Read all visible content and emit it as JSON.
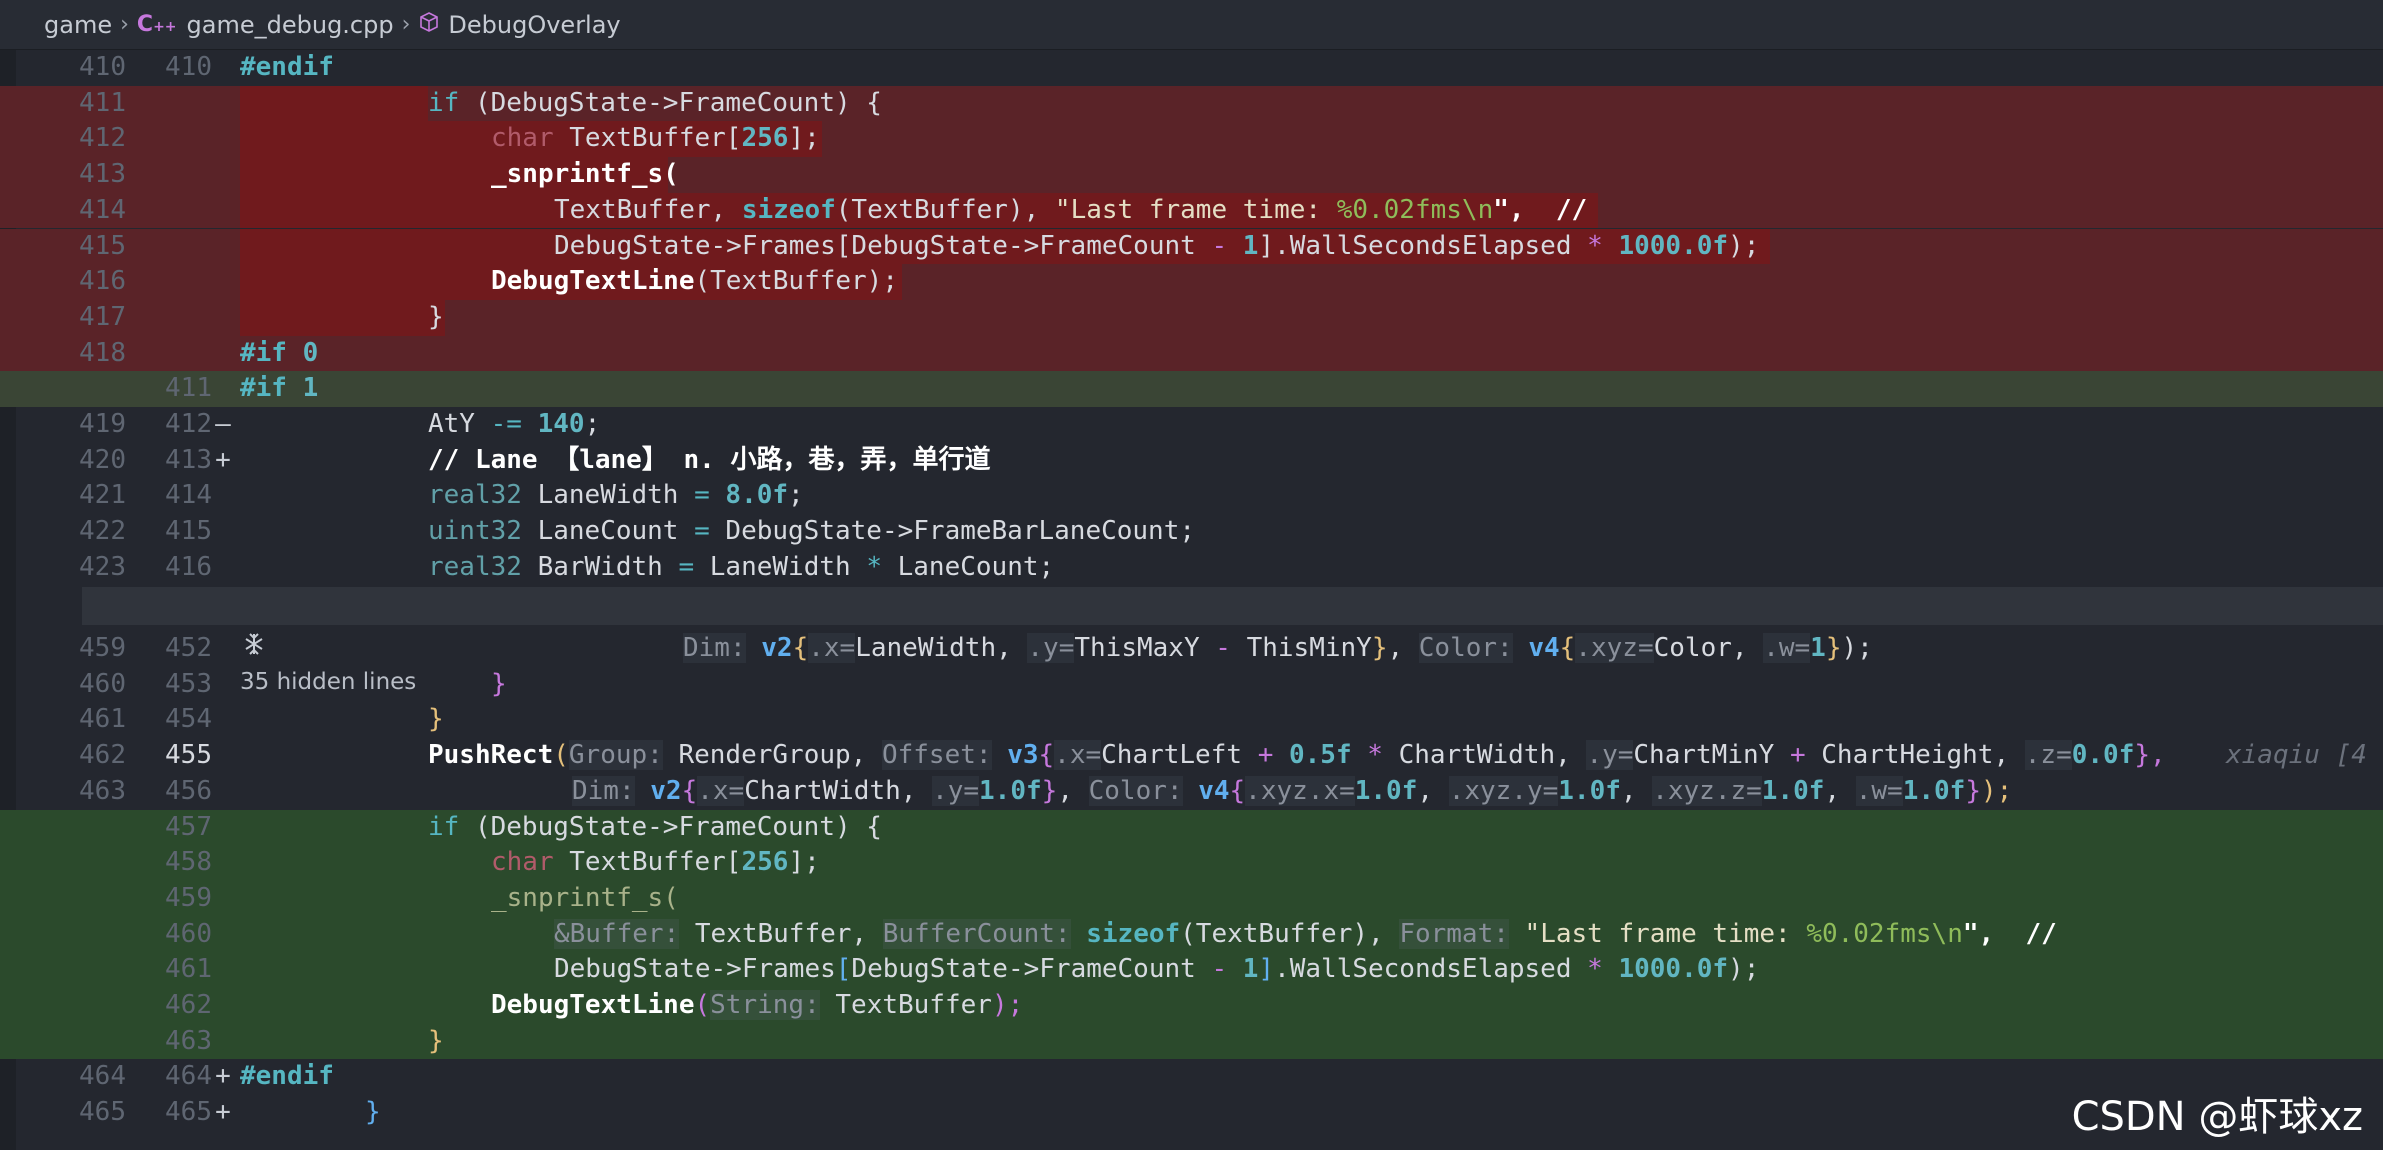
{
  "breadcrumb": {
    "items": [
      "game",
      "game_debug.cpp",
      "DebugOverlay"
    ],
    "file_icon_label": "C++"
  },
  "folded": {
    "label": "35 hidden lines"
  },
  "blame": {
    "text": "xiaqiu [4"
  },
  "watermark": {
    "text": "CSDN @虾球xz"
  },
  "lines": [
    {
      "type": "neutral",
      "ln1": "410",
      "ln2": "410",
      "marker": ""
    },
    {
      "type": "del",
      "ln1": "411",
      "ln2": "",
      "marker": "—"
    },
    {
      "type": "del",
      "ln1": "412",
      "ln2": "",
      "marker": "—"
    },
    {
      "type": "del",
      "ln1": "413",
      "ln2": "",
      "marker": "—"
    },
    {
      "type": "del",
      "ln1": "414",
      "ln2": "",
      "marker": "—"
    },
    {
      "type": "del",
      "ln1": "415",
      "ln2": "",
      "marker": "—"
    },
    {
      "type": "del",
      "ln1": "416",
      "ln2": "",
      "marker": "—"
    },
    {
      "type": "del",
      "ln1": "417",
      "ln2": "",
      "marker": "—"
    },
    {
      "type": "del",
      "ln1": "418",
      "ln2": "",
      "marker": "—"
    },
    {
      "type": "addplain",
      "ln1": "",
      "ln2": "411",
      "marker": "+"
    },
    {
      "type": "neutral",
      "ln1": "419",
      "ln2": "412",
      "marker": ""
    },
    {
      "type": "neutral",
      "ln1": "420",
      "ln2": "413",
      "marker": ""
    },
    {
      "type": "neutral",
      "ln1": "421",
      "ln2": "414",
      "marker": ""
    },
    {
      "type": "neutral",
      "ln1": "422",
      "ln2": "415",
      "marker": ""
    },
    {
      "type": "neutral",
      "ln1": "423",
      "ln2": "416",
      "marker": ""
    },
    {
      "type": "neutral",
      "ln1": "459",
      "ln2": "452",
      "marker": ""
    },
    {
      "type": "neutral",
      "ln1": "460",
      "ln2": "453",
      "marker": ""
    },
    {
      "type": "neutral",
      "ln1": "461",
      "ln2": "454",
      "marker": ""
    },
    {
      "type": "neutral",
      "ln1": "462",
      "ln2": "455",
      "marker": ""
    },
    {
      "type": "neutral",
      "ln1": "463",
      "ln2": "456",
      "marker": ""
    },
    {
      "type": "add",
      "ln1": "",
      "ln2": "457",
      "marker": "+"
    },
    {
      "type": "add",
      "ln1": "",
      "ln2": "458",
      "marker": "+"
    },
    {
      "type": "add",
      "ln1": "",
      "ln2": "459",
      "marker": "+"
    },
    {
      "type": "add",
      "ln1": "",
      "ln2": "460",
      "marker": "+"
    },
    {
      "type": "add",
      "ln1": "",
      "ln2": "461",
      "marker": "+"
    },
    {
      "type": "add",
      "ln1": "",
      "ln2": "462",
      "marker": "+"
    },
    {
      "type": "add",
      "ln1": "",
      "ln2": "463",
      "marker": "+"
    },
    {
      "type": "neutral",
      "ln1": "464",
      "ln2": "464",
      "marker": ""
    },
    {
      "type": "neutral",
      "ln1": "465",
      "ln2": "465",
      "marker": ""
    }
  ],
  "code": {
    "l410": "#endif",
    "l411a": "if",
    "l411b": " (DebugState->FrameCount) {",
    "l412a": "char",
    "l412b": " TextBuffer[",
    "l412c": "256",
    "l412d": "];",
    "l413": "_snprintf_s(",
    "l414a": "TextBuffer, ",
    "l414b": "sizeof",
    "l414c": "(TextBuffer), ",
    "l414d": "\"Last frame time: ",
    "l414e": "%0.02fms\\n",
    "l414f": "\",  //",
    "l415a": "DebugState->Frames[DebugState->FrameCount ",
    "l415b": "-",
    "l415c": " 1",
    "l415d": "].WallSecondsElapsed ",
    "l415e": "*",
    "l415f": " 1000.0f",
    "l415g": ");",
    "l416a": "DebugTextLine",
    "l416b": "(TextBuffer);",
    "l417": "}",
    "l418a": "#if",
    "l418b": " 0",
    "l411na": "#if",
    "l411nb": " 1",
    "l412na": "AtY ",
    "l412nb": "-=",
    "l412nc": " 140",
    "l412nd": ";",
    "l413n": "// Lane 【lane】 n. 小路，巷，弄，单行道",
    "l414na": "real32",
    "l414nb": " LaneWidth ",
    "l414nc": "=",
    "l414nd": " 8.0f",
    "l414ne": ";",
    "l415na": "uint32",
    "l415nb": " LaneCount ",
    "l415nc": "=",
    "l415nd": " DebugState->FrameBarLaneCount;",
    "l416na": "real32",
    "l416nb": " BarWidth ",
    "l416nc": "=",
    "l416nd": " LaneWidth ",
    "l416ne": "*",
    "l416nf": " LaneCount;",
    "l452a": "Dim:",
    "l452b": "v2",
    "l452c": "{",
    "l452d": ".x=",
    "l452e": "LaneWidth, ",
    "l452f": ".y=",
    "l452g": "ThisMaxY ",
    "l452h": "-",
    "l452i": " ThisMinY",
    "l452j": "}",
    "l452k": ", ",
    "l452l": "Color:",
    "l452m": "v4",
    "l452n": "{",
    "l452o": ".xyz=",
    "l452p": "Color, ",
    "l452q": ".w=",
    "l452r": "1",
    "l452s": "}",
    "l452t": ");",
    "l453": "}",
    "l454": "}",
    "l455a": "PushRect",
    "l455b": "(",
    "l455c": "Group:",
    "l455d": "RenderGroup, ",
    "l455e": "Offset:",
    "l455f": "v3",
    "l455g": "{",
    "l455h": ".x=",
    "l455i": "ChartLeft ",
    "l455j": "+",
    "l455k": " 0.5f",
    "l455l": " * ",
    "l455m": "ChartWidth, ",
    "l455n": ".y=",
    "l455o": "ChartMinY ",
    "l455p": "+",
    "l455q": " ChartHeight, ",
    "l455r": ".z=",
    "l455s": "0.0f",
    "l455t": "},",
    "l456a": "Dim:",
    "l456b": "v2",
    "l456c": "{",
    "l456d": ".x=",
    "l456e": "ChartWidth, ",
    "l456f": ".y=",
    "l456g": "1.0f",
    "l456h": "}",
    "l456i": ", ",
    "l456j": "Color:",
    "l456k": "v4",
    "l456l": "{",
    "l456m": ".xyz.x=",
    "l456n": "1.0f",
    "l456o": ", ",
    "l456p": ".xyz.y=",
    "l456q": "1.0f",
    "l456r": ", ",
    "l456s": ".xyz.z=",
    "l456t": "1.0f",
    "l456u": ", ",
    "l456v": ".w=",
    "l456w": "1.0f",
    "l456x": "}",
    "l456y": ");",
    "l457a": "if",
    "l457b": " (DebugState->FrameCount) {",
    "l458a": "char",
    "l458b": " TextBuffer[",
    "l458c": "256",
    "l458d": "];",
    "l459": "_snprintf_s(",
    "l460a": "&Buffer:",
    "l460b": "TextBuffer, ",
    "l460c": "BufferCount:",
    "l460d": "sizeof",
    "l460e": "(TextBuffer)",
    "l460f": ", ",
    "l460g": "Format:",
    "l460h": "\"Last frame time: ",
    "l460i": "%0.02fms\\n",
    "l460j": "\",  //",
    "l461a": "DebugState->Frames",
    "l461b": "[",
    "l461c": "DebugState->FrameCount ",
    "l461d": "-",
    "l461e": " 1",
    "l461f": "]",
    "l461g": ".WallSecondsElapsed ",
    "l461h": "*",
    "l461i": " 1000.0f",
    "l461j": ");",
    "l462a": "DebugTextLine",
    "l462b": "(",
    "l462c": "String:",
    "l462d": "TextBuffer",
    "l462e": ");",
    "l463": "}",
    "l464": "#endif",
    "l465": "}"
  },
  "colors": {
    "deleted_line_bg": "#5a2328",
    "deleted_code_bg": "#701a1d",
    "added_line_bg": "#2b4a2c",
    "editor_bg": "#24272f"
  }
}
